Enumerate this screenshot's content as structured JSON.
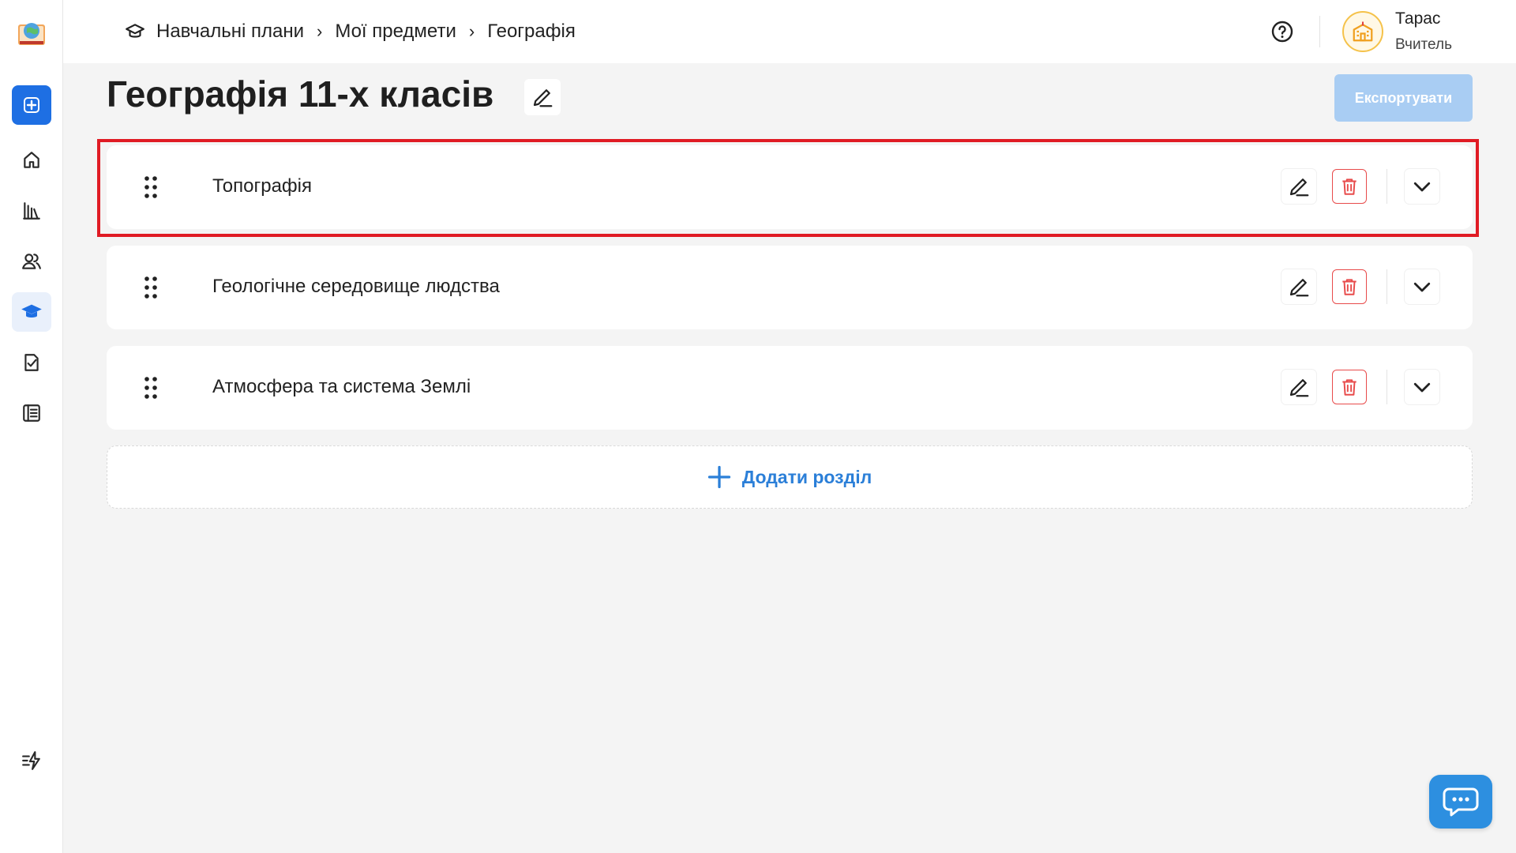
{
  "header": {
    "breadcrumb": [
      {
        "label": "Навчальні плани"
      },
      {
        "label": "Мої предмети"
      },
      {
        "label": "Географія"
      }
    ],
    "user": {
      "name": "Тарас",
      "role": "Вчитель"
    }
  },
  "page": {
    "title": "Географія 11-х класів",
    "export_label": "Експортувати"
  },
  "sections": [
    {
      "title": "Топографія"
    },
    {
      "title": "Геологічне середовище людства"
    },
    {
      "title": "Атмосфера та система Землі"
    }
  ],
  "add_section_label": "Додати розділ",
  "colors": {
    "primary": "#1e6fe3",
    "accent_link": "#2b7fd8",
    "export_disabled": "#a9cdf3",
    "danger": "#e84b4b",
    "highlight": "#e01b24",
    "chat": "#2d8fe0"
  },
  "icons": {
    "sidebar": [
      "add-icon",
      "home-icon",
      "library-icon",
      "users-icon",
      "graduation-cap-icon",
      "assignment-icon",
      "journal-icon",
      "quick-actions-icon"
    ]
  }
}
